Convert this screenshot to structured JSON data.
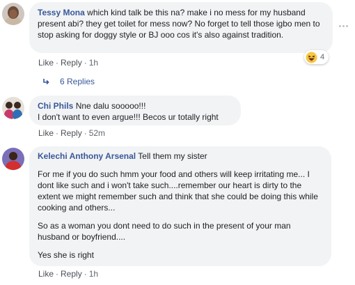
{
  "comments": [
    {
      "author": "Tessy Mona",
      "text": "which kind talk be this na? make i no mess for my husband present abi? they get toilet for mess now? No forget to tell those igbo men to stop asking for doggy style or BJ ooo cos it's also against tradition.",
      "like": "Like",
      "reply": "Reply",
      "time": "1h",
      "reaction_count": "4",
      "reaction_icon": "haha-emoji-icon",
      "replies_label": "6 Replies"
    },
    {
      "author": "Chi Phils",
      "text_line1": "Nne dalu sooooo!!!",
      "text_line2": "I don't want to even argue!!! Becos ur totally right",
      "like": "Like",
      "reply": "Reply",
      "time": "52m"
    },
    {
      "author": "Kelechi Anthony Arsenal",
      "text_first": "Tell them my sister",
      "paragraph1": "For me if you do such hmm your food and others will keep irritating me... I dont like such and i won't take such....remember our heart is dirty to the extent we might remember such and think that she could be doing this while cooking and others...",
      "paragraph2": "So as a woman you dont need to do such in the present of your man husband or boyfriend....",
      "paragraph3": "Yes she is right",
      "like": "Like",
      "reply": "Reply",
      "time": "1h"
    }
  ],
  "separator": "·",
  "colors": {
    "author": "#385898",
    "bubble": "#f2f3f5",
    "meta": "#606770"
  }
}
